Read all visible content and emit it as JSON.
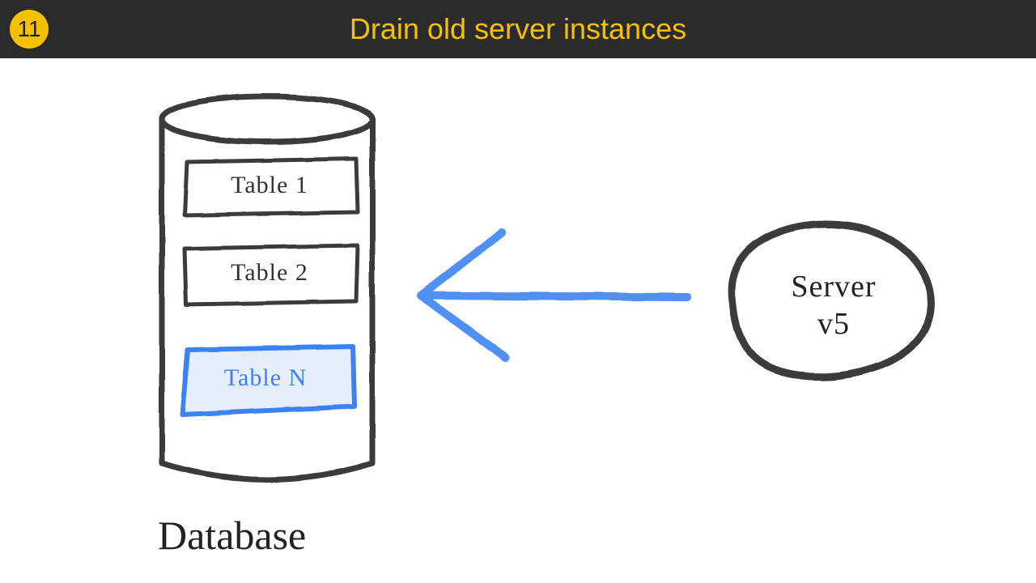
{
  "header": {
    "step_number": "11",
    "title": "Drain old server instances"
  },
  "database": {
    "caption": "Database",
    "tables": [
      {
        "label": "Table 1",
        "highlighted": false
      },
      {
        "label": "Table 2",
        "highlighted": false
      },
      {
        "label": "Table N",
        "highlighted": true
      }
    ]
  },
  "server": {
    "line1": "Server",
    "line2": "v5"
  },
  "colors": {
    "accent_yellow": "#f6c100",
    "header_bg": "#2b2b2b",
    "ink": "#3a3a3a",
    "blue": "#3b82f6",
    "blue_fill": "#e6eefc"
  }
}
